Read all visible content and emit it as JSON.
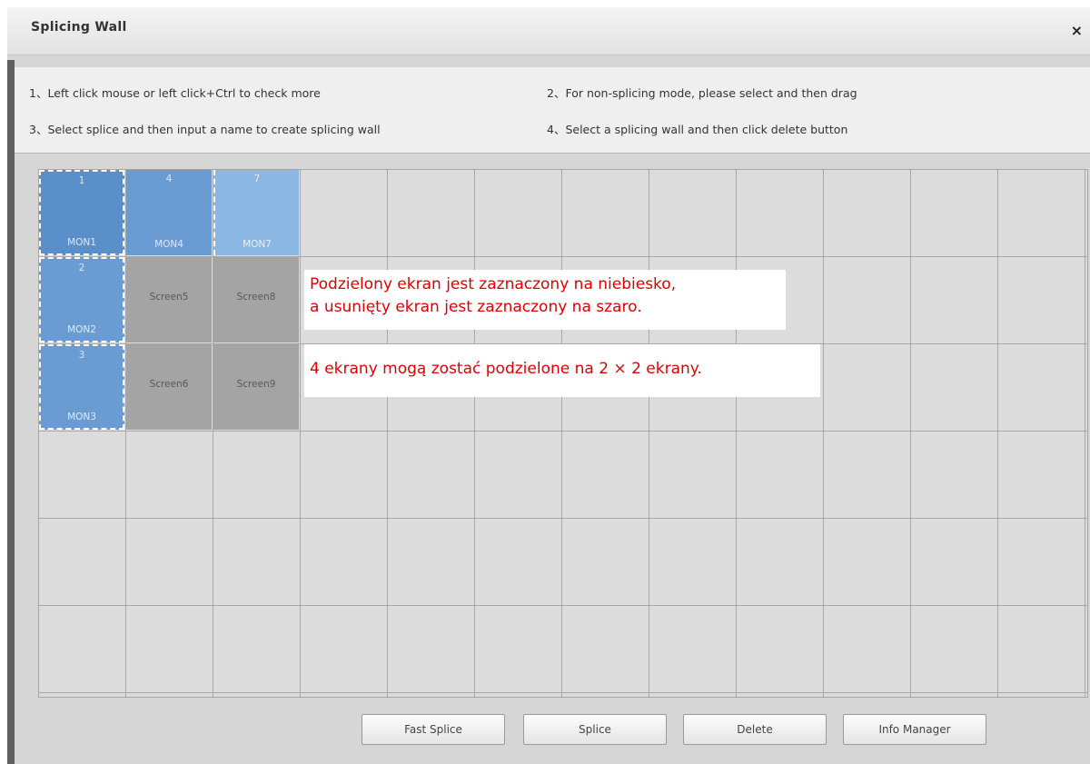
{
  "dialog": {
    "title": "Splicing Wall",
    "close_icon": "×"
  },
  "hints": [
    "1、Left click mouse or left click+Ctrl to check more",
    "2、For non-splicing mode, please select and then drag",
    "3、Select splice and then input a name to create splicing wall",
    "4、Select a splicing wall and then click delete button"
  ],
  "cells": [
    {
      "num": "1",
      "label": "MON1"
    },
    {
      "num": "4",
      "label": "MON4"
    },
    {
      "num": "7",
      "label": "MON7"
    },
    {
      "num": "2",
      "label": "MON2"
    },
    {
      "num": "3",
      "label": "MON3"
    },
    {
      "label": "Screen5"
    },
    {
      "label": "Screen8"
    },
    {
      "label": "Screen6"
    },
    {
      "label": "Screen9"
    }
  ],
  "notes": {
    "blue_gray_line1": "Podzielony ekran jest zaznaczony na niebiesko,",
    "blue_gray_line2": "a usunięty ekran jest zaznaczony na szaro.",
    "split": "4 ekrany mogą zostać podzielone na 2 × 2 ekrany."
  },
  "buttons": {
    "fast_splice": "Fast Splice",
    "splice": "Splice",
    "delete": "Delete",
    "info_manager": "Info Manager"
  },
  "colors": {
    "selected_blue": "#5b8fc9",
    "deleted_gray": "#a4a4a4",
    "annotation_red": "#e00000"
  }
}
